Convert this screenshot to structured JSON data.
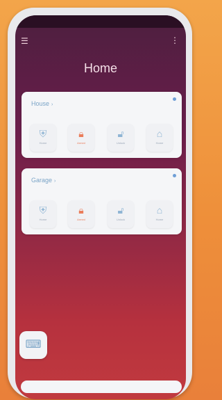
{
  "header": {
    "title": "Home"
  },
  "cards": [
    {
      "title": "House",
      "modes": [
        {
          "label": "Home",
          "icon": "shield-icon"
        },
        {
          "label": "Armed",
          "icon": "lock-icon",
          "active": true
        },
        {
          "label": "Unlock",
          "icon": "unlock-icon"
        },
        {
          "label": "Home",
          "icon": "house-icon"
        }
      ]
    },
    {
      "title": "Garage",
      "modes": [
        {
          "label": "Home",
          "icon": "shield-icon"
        },
        {
          "label": "Armed",
          "icon": "lock-icon",
          "active": true
        },
        {
          "label": "Unlock",
          "icon": "unlock-icon"
        },
        {
          "label": "Home",
          "icon": "house-icon"
        }
      ]
    }
  ],
  "colors": {
    "accent_active": "#ea7d5b",
    "accent_idle": "#8fb5d4"
  }
}
